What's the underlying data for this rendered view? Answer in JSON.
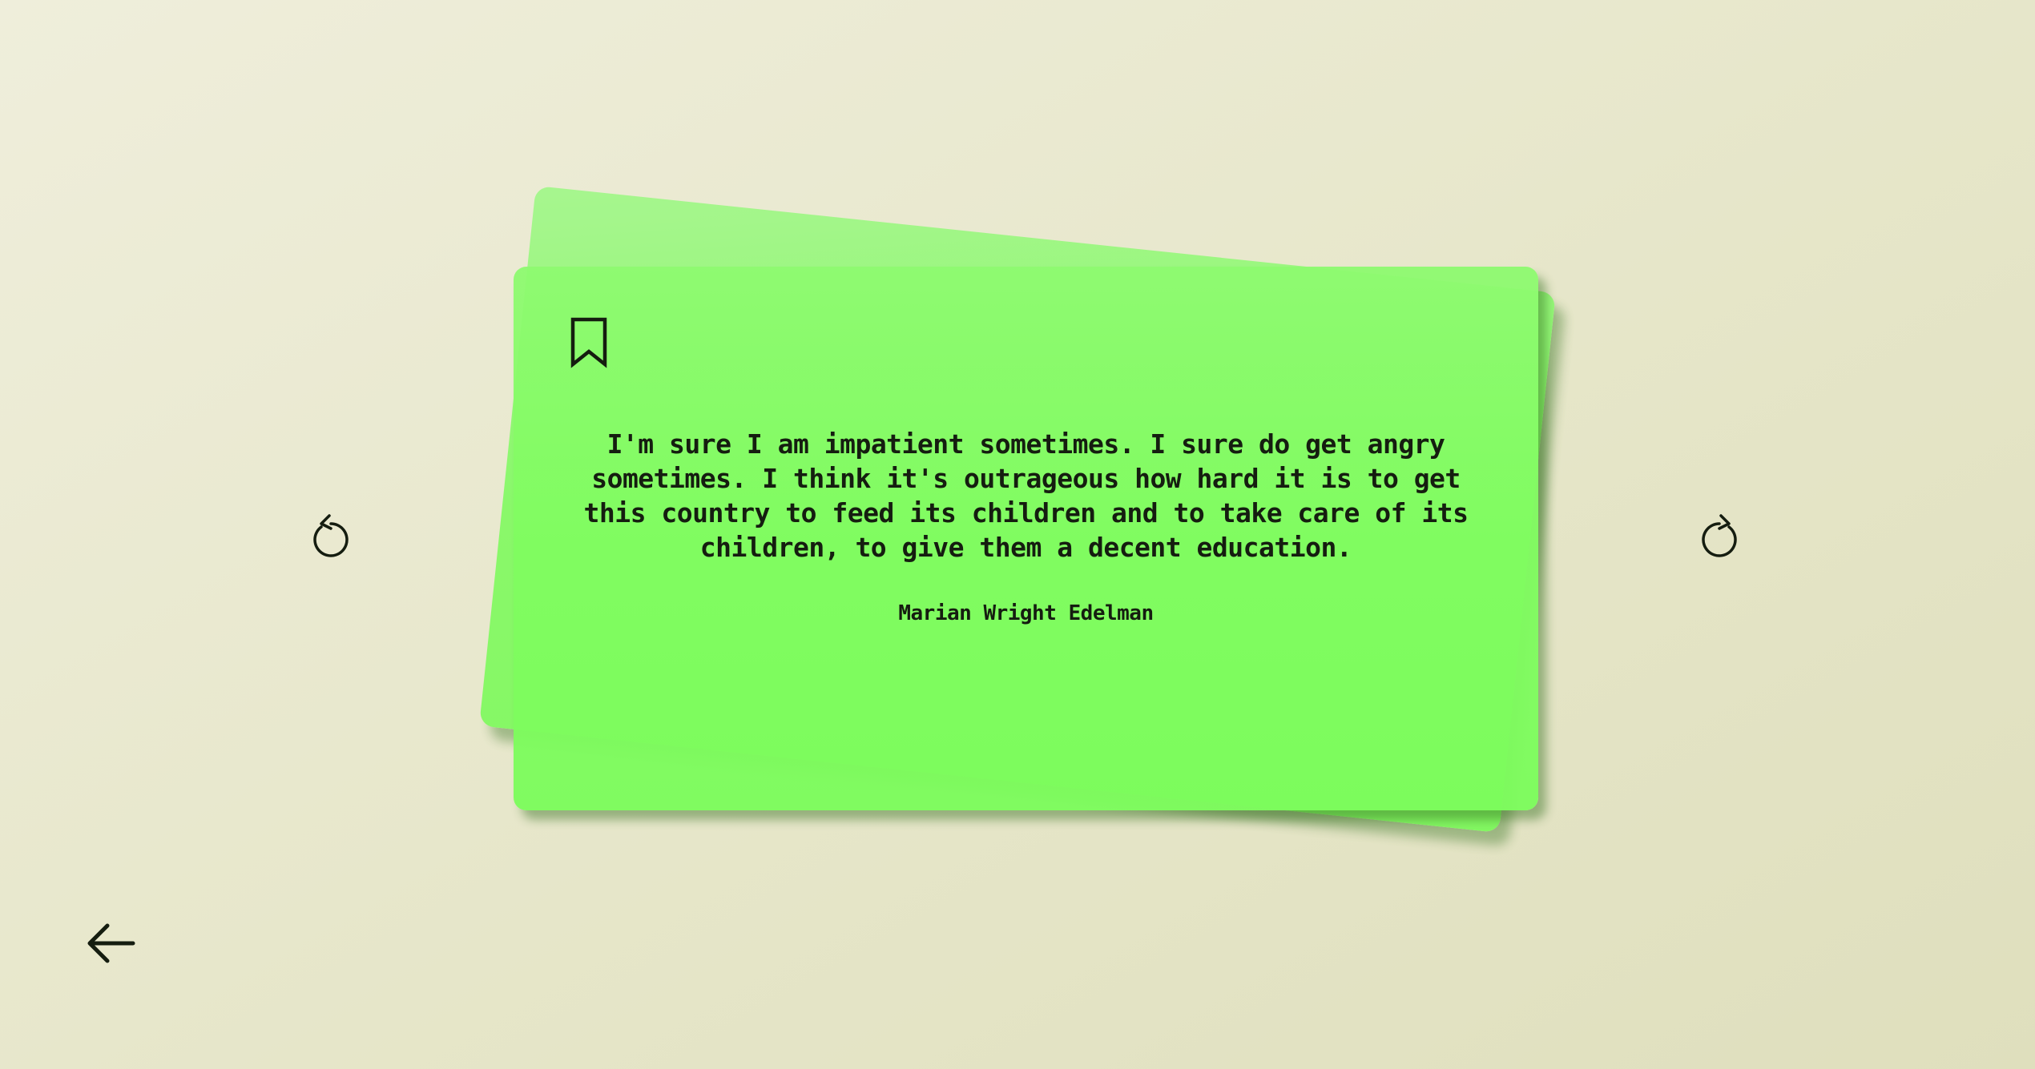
{
  "card": {
    "quote": "I'm sure I am impatient sometimes. I sure do get angry sometimes. I think it's outrageous how hard it is to get this country to feed its children and to take care of its children, to give them a decent education.",
    "author": "Marian Wright Edelman"
  },
  "icons": {
    "bookmark": "bookmark-icon",
    "rotate_left": "rotate-counterclockwise-icon",
    "rotate_right": "rotate-clockwise-icon",
    "back": "arrow-left-icon"
  },
  "colors": {
    "background": "#e8e8cc",
    "card": "#80fb60",
    "text": "#151d10"
  }
}
